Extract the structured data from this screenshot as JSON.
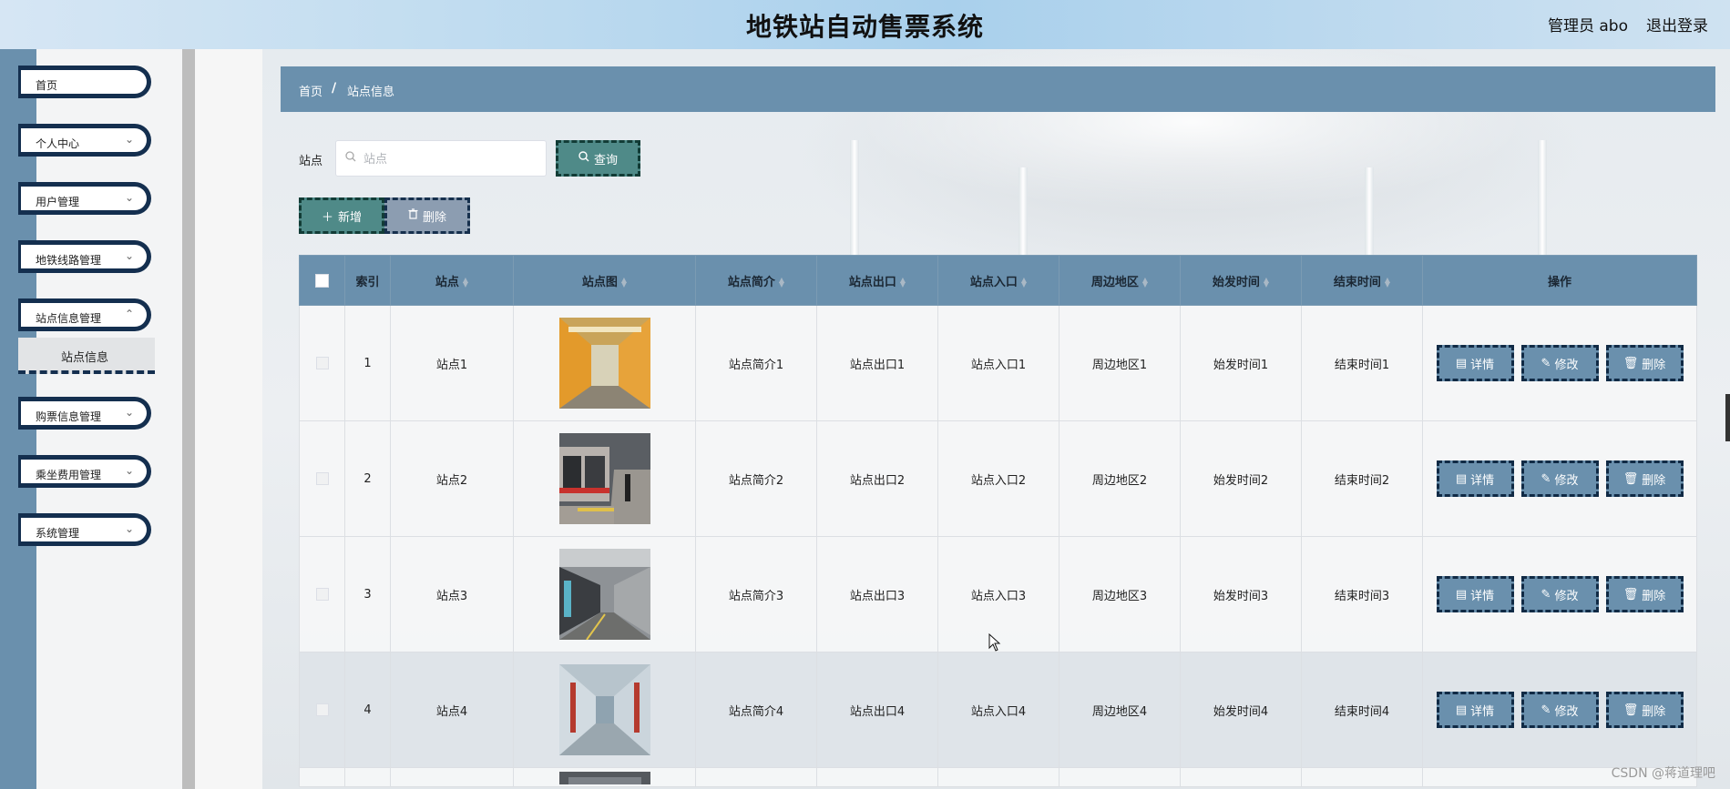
{
  "header": {
    "title": "地铁站自动售票系统",
    "user": "管理员 abo",
    "logout": "退出登录"
  },
  "sidebar": {
    "items": [
      {
        "label": "首页",
        "chevron": false
      },
      {
        "label": "个人中心",
        "chevron": true
      },
      {
        "label": "用户管理",
        "chevron": true
      },
      {
        "label": "地铁线路管理",
        "chevron": true
      },
      {
        "label": "站点信息管理",
        "chevron": true
      },
      {
        "label": "购票信息管理",
        "chevron": true
      },
      {
        "label": "乘坐费用管理",
        "chevron": true
      },
      {
        "label": "系统管理",
        "chevron": true
      }
    ],
    "submenu": {
      "label": "站点信息"
    }
  },
  "breadcrumb": {
    "home": "首页",
    "separator": "/",
    "current": "站点信息"
  },
  "search": {
    "label": "站点",
    "placeholder": "站点",
    "value": "",
    "query_button": "查询"
  },
  "actions": {
    "add": "新增",
    "delete": "删除"
  },
  "table": {
    "columns": [
      "索引",
      "站点",
      "站点图",
      "站点简介",
      "站点出口",
      "站点入口",
      "周边地区",
      "始发时间",
      "结束时间",
      "操作"
    ],
    "row_buttons": {
      "detail": "详情",
      "edit": "修改",
      "delete": "删除"
    },
    "rows": [
      {
        "index": "1",
        "station": "站点1",
        "intro": "站点简介1",
        "exit": "站点出口1",
        "entry": "站点入口1",
        "area": "周边地区1",
        "start": "始发时间1",
        "end": "结束时间1"
      },
      {
        "index": "2",
        "station": "站点2",
        "intro": "站点简介2",
        "exit": "站点出口2",
        "entry": "站点入口2",
        "area": "周边地区2",
        "start": "始发时间2",
        "end": "结束时间2"
      },
      {
        "index": "3",
        "station": "站点3",
        "intro": "站点简介3",
        "exit": "站点出口3",
        "entry": "站点入口3",
        "area": "周边地区3",
        "start": "始发时间3",
        "end": "结束时间3"
      },
      {
        "index": "4",
        "station": "站点4",
        "intro": "站点简介4",
        "exit": "站点出口4",
        "entry": "站点入口4",
        "area": "周边地区4",
        "start": "始发时间4",
        "end": "结束时间4"
      }
    ]
  },
  "watermark": "CSDN @蒋道理吧",
  "colors": {
    "primary": "#6a90ad",
    "teal": "#4f8a88",
    "navy": "#142f4f"
  }
}
